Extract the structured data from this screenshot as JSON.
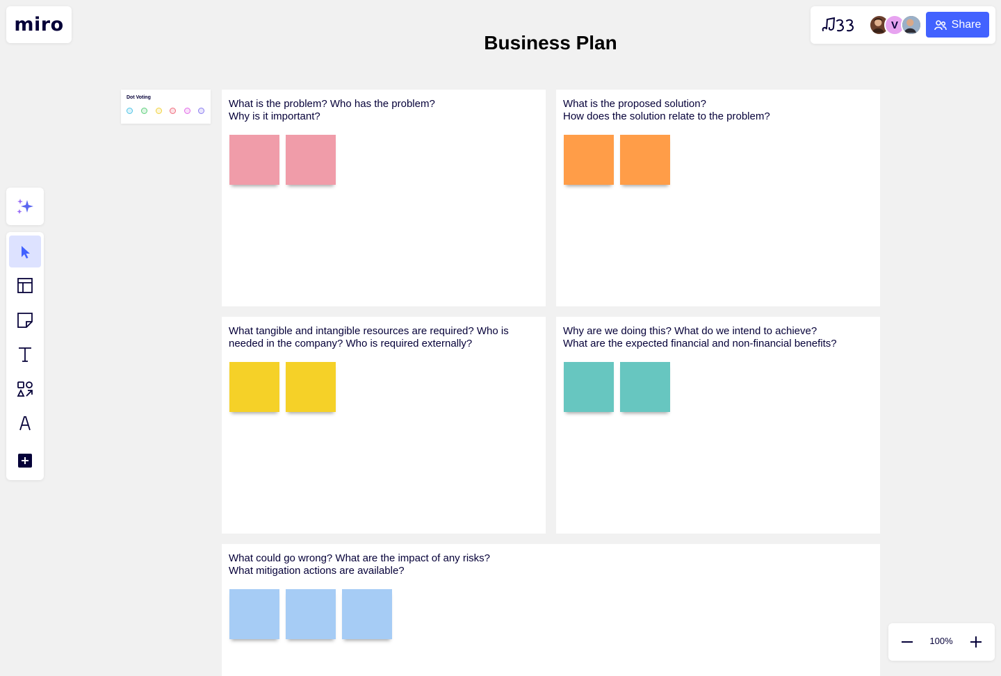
{
  "app": {
    "logo": "miro"
  },
  "board": {
    "title": "Business Plan"
  },
  "header": {
    "avatars": [
      {
        "name": "user-avatar-1",
        "initial": ""
      },
      {
        "name": "user-avatar-2",
        "initial": "V"
      },
      {
        "name": "user-avatar-3",
        "initial": ""
      }
    ],
    "share_label": "Share"
  },
  "dot_voting": {
    "title": "Dot Voting",
    "dot_colors": [
      "#4fc3e6",
      "#5ccf7a",
      "#f2d23c",
      "#ef6b7c",
      "#e26ae8",
      "#8a7cf0"
    ]
  },
  "toolbar": {
    "tools": [
      {
        "name": "select-tool",
        "icon": "cursor-icon",
        "active": true
      },
      {
        "name": "templates-tool",
        "icon": "layout-icon",
        "active": false
      },
      {
        "name": "sticky-note-tool",
        "icon": "sticky-note-icon",
        "active": false
      },
      {
        "name": "text-tool",
        "icon": "text-icon",
        "active": false
      },
      {
        "name": "shapes-tool",
        "icon": "shapes-icon",
        "active": false
      },
      {
        "name": "pen-tool",
        "icon": "pen-icon",
        "active": false
      },
      {
        "name": "more-tools",
        "icon": "plus-square-icon",
        "active": false
      }
    ]
  },
  "frames": [
    {
      "lines": [
        "What is the problem? Who has the problem?",
        "Why is it important?"
      ],
      "sticky_color": "#f09ca9",
      "sticky_count": 2
    },
    {
      "lines": [
        "What is the proposed solution?",
        "How does the solution relate to the problem?"
      ],
      "sticky_color": "#ff9d48",
      "sticky_count": 2
    },
    {
      "lines": [
        "What tangible and intangible resources are required? Who is",
        "needed in the company? Who is required externally?"
      ],
      "sticky_color": "#f5d128",
      "sticky_count": 2
    },
    {
      "lines": [
        "Why are we doing this? What do we intend to achieve?",
        "What are the expected financial and non-financial benefits?"
      ],
      "sticky_color": "#67c6c0",
      "sticky_count": 2
    },
    {
      "lines": [
        "What could go wrong? What are the impact of any risks?",
        "What mitigation actions are available?"
      ],
      "sticky_color": "#a6ccf5",
      "sticky_count": 3
    }
  ],
  "zoom": {
    "level": "100%"
  }
}
